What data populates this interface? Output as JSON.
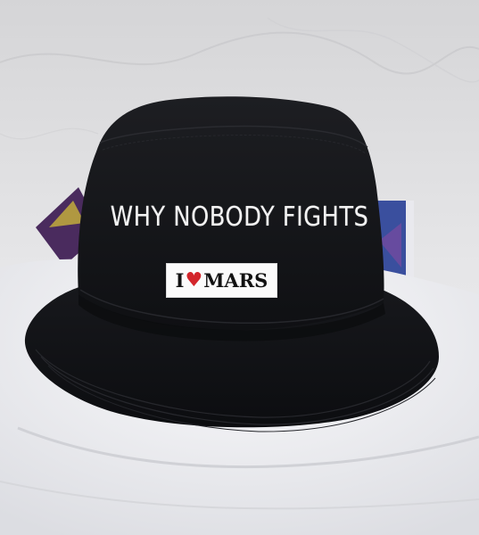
{
  "image": {
    "subject": "black bucket hat",
    "embroidery": {
      "headline": "WHY NOBODY FIGHTS",
      "patch_prefix": "I",
      "patch_heart": "♥",
      "patch_word": "MARS"
    },
    "colors": {
      "hat": "#141518",
      "background": "#e9e9ea",
      "cloth": "#f2f2f4",
      "heart": "#d3252b",
      "patch": "#fbfbfb"
    }
  }
}
